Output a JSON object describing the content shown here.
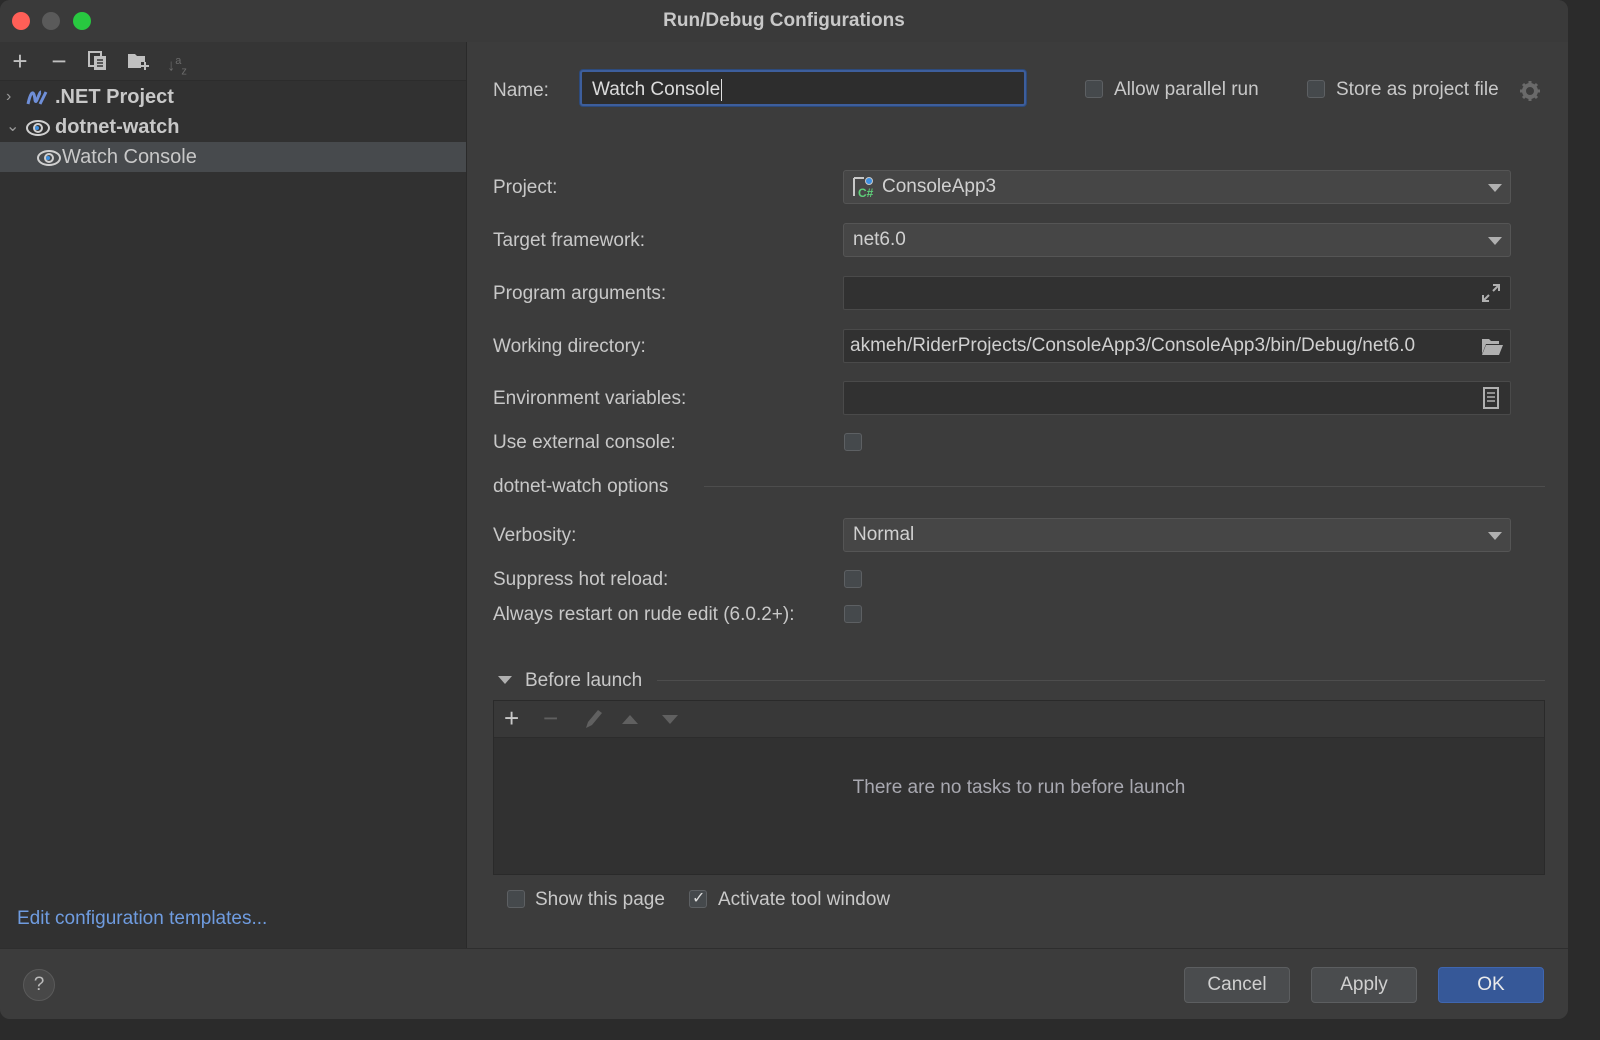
{
  "window": {
    "title": "Run/Debug Configurations"
  },
  "sidebar": {
    "toolbar": [
      {
        "name": "add-icon",
        "glyph": "+"
      },
      {
        "name": "remove-icon",
        "glyph": "−"
      },
      {
        "name": "copy-icon",
        "glyph": "⧉"
      },
      {
        "name": "new-folder-icon",
        "glyph": "▰"
      },
      {
        "name": "sort-icon",
        "glyph": "↓ᵃz"
      }
    ],
    "tree": [
      {
        "label": ".NET Project",
        "expanded": false,
        "icon": "dotnet-icon"
      },
      {
        "label": "dotnet-watch",
        "expanded": true,
        "icon": "eye-icon"
      },
      {
        "label": "Watch Console",
        "selected": true,
        "icon": "eye-icon"
      }
    ],
    "edit_templates_link": "Edit configuration templates..."
  },
  "form": {
    "name_label": "Name:",
    "name_value": "Watch Console",
    "allow_parallel_label": "Allow parallel run",
    "allow_parallel_checked": false,
    "store_project_label": "Store as project file",
    "store_project_checked": false,
    "project_label": "Project:",
    "project_value": "ConsoleApp3",
    "target_framework_label": "Target framework:",
    "target_framework_value": "net6.0",
    "program_args_label": "Program arguments:",
    "program_args_value": "",
    "working_dir_label": "Working directory:",
    "working_dir_value": "akmeh/RiderProjects/ConsoleApp3/ConsoleApp3/bin/Debug/net6.0",
    "env_vars_label": "Environment variables:",
    "env_vars_value": "",
    "external_console_label": "Use external console:",
    "external_console_checked": false,
    "section_title": "dotnet-watch options",
    "verbosity_label": "Verbosity:",
    "verbosity_value": "Normal",
    "suppress_hot_reload_label": "Suppress hot reload:",
    "suppress_hot_reload_checked": false,
    "always_restart_label": "Always restart on rude edit (6.0.2+):",
    "always_restart_checked": false
  },
  "before_launch": {
    "title": "Before launch",
    "empty_text": "There are no tasks to run before launch",
    "show_page_label": "Show this page",
    "show_page_checked": false,
    "activate_tool_label": "Activate tool window",
    "activate_tool_checked": true
  },
  "footer": {
    "help": "?",
    "cancel": "Cancel",
    "apply": "Apply",
    "ok": "OK"
  }
}
